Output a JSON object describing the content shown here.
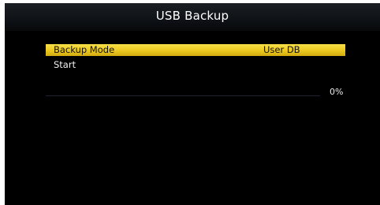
{
  "title": "USB Backup",
  "menu": {
    "items": [
      {
        "label": "Backup Mode",
        "value": "User DB",
        "selected": true
      },
      {
        "label": "Start",
        "value": "",
        "selected": false
      }
    ]
  },
  "progress": {
    "percent_label": "0%",
    "value": 0
  },
  "colors": {
    "selection_highlight": "#efcd24",
    "background": "#000000",
    "title_text": "#ffffff"
  }
}
